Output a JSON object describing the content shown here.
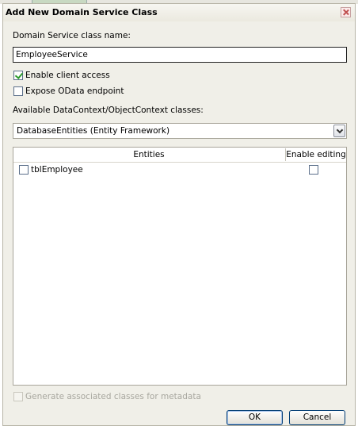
{
  "window": {
    "title": "Add New Domain Service Class"
  },
  "form": {
    "class_name_label": "Domain Service class name:",
    "class_name_value": "EmployeeService",
    "enable_client_access_label": "Enable client access",
    "enable_client_access_checked": true,
    "expose_odata_label": "Expose OData endpoint",
    "expose_odata_checked": false,
    "context_label": "Available DataContext/ObjectContext classes:",
    "context_selected": "DatabaseEntities (Entity Framework)"
  },
  "entities_grid": {
    "columns": [
      "Entities",
      "Enable editing"
    ],
    "rows": [
      {
        "name": "tblEmployee",
        "selected": false,
        "enable_editing": false
      }
    ]
  },
  "metadata": {
    "label": "Generate associated classes for metadata",
    "checked": false,
    "enabled": false
  },
  "buttons": {
    "ok": "OK",
    "cancel": "Cancel"
  },
  "icons": {
    "close": "close-icon",
    "dropdown": "chevron-down-icon"
  },
  "colors": {
    "dialog_bg": "#f0efe8",
    "button_border": "#003c74",
    "check_mark": "#2a9a2a"
  }
}
